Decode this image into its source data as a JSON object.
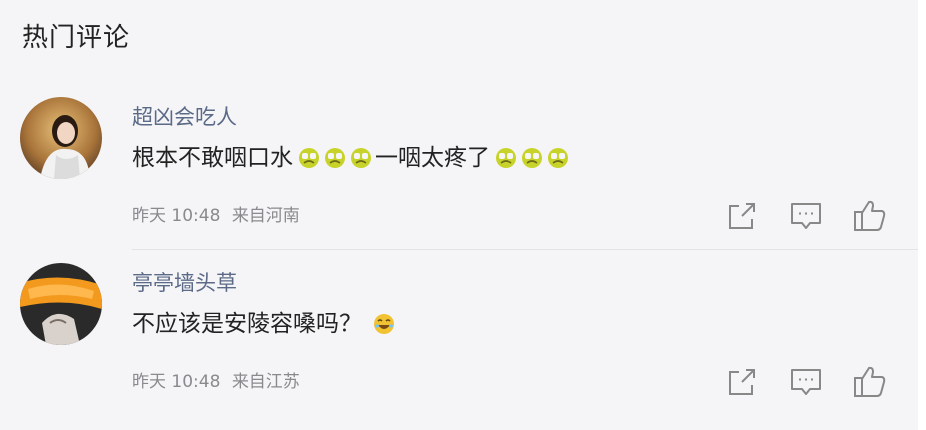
{
  "section": {
    "title": "热门评论"
  },
  "comments": [
    {
      "username": "超凶会吃人",
      "text_before": "根本不敢咽口水",
      "text_after": "一咽太疼了",
      "time": "昨天 10:48",
      "location": "来自河南",
      "emoji_name": "crying-emoji"
    },
    {
      "username": "亭亭墙头草",
      "text_before": "不应该是安陵容嗓吗？",
      "text_after": "",
      "time": "昨天 10:48",
      "location": "来自江苏",
      "emoji_name": "laughing-emoji"
    }
  ],
  "icons": {
    "share": "share-icon",
    "comment": "comment-icon",
    "like": "thumbs-up-icon"
  },
  "colors": {
    "username": "#5b6a87",
    "meta": "#8a8a8e",
    "background": "#f5f5f7",
    "emoji": "#c8d32a"
  }
}
